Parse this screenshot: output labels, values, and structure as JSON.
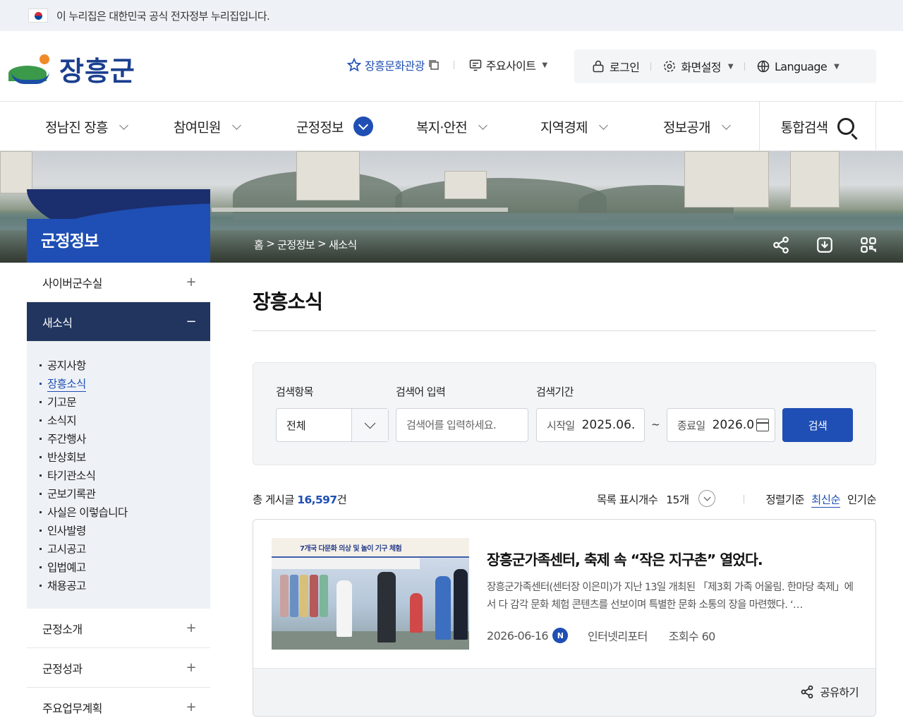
{
  "gov_banner": {
    "text": "이 누리집은 대한민국 공식 전자정부 누리집입니다."
  },
  "header": {
    "logo_text": "장흥군",
    "culture_tour": "장흥문화관광",
    "main_sites": "주요사이트",
    "login": "로그인",
    "screen_settings": "화면설정",
    "language": "Language"
  },
  "gnb": {
    "items": [
      {
        "label": "정남진 장흥"
      },
      {
        "label": "참여민원"
      },
      {
        "label": "군정정보"
      },
      {
        "label": "복지·안전"
      },
      {
        "label": "지역경제"
      },
      {
        "label": "정보공개"
      }
    ],
    "active_index": 2,
    "search_label": "통합검색"
  },
  "visual": {
    "section_title": "군정정보",
    "breadcrumb": [
      "홈",
      "군정정보",
      "새소식"
    ]
  },
  "lnb": {
    "items": [
      {
        "label": "사이버군수실",
        "toggle": "+"
      },
      {
        "label": "새소식",
        "toggle": "−"
      },
      {
        "label": "군정소개",
        "toggle": "+"
      },
      {
        "label": "군정성과",
        "toggle": "+"
      },
      {
        "label": "주요업무계획",
        "toggle": "+"
      }
    ],
    "sub_items": [
      "공지사항",
      "장흥소식",
      "기고문",
      "소식지",
      "주간행사",
      "반상회보",
      "타기관소식",
      "군보기록관",
      "사실은 이렇습니다",
      "인사발령",
      "고시공고",
      "입법예고",
      "채용공고"
    ],
    "sub_active_index": 1
  },
  "content": {
    "title": "장흥소식"
  },
  "search": {
    "label_category": "검색항목",
    "label_keyword": "검색어 입력",
    "label_period": "검색기간",
    "category_value": "전체",
    "keyword_placeholder": "검색어를 입력하세요.",
    "start_label": "시작일",
    "start_value": "2025.06.",
    "tilde": "~",
    "end_label": "종료일",
    "end_value": "2026.0",
    "button": "검색"
  },
  "list_bar": {
    "total_prefix": "총 게시글",
    "total_count": "16,597",
    "total_suffix": "건",
    "per_page_label": "목록 표시개수",
    "per_page_value": "15개",
    "sort_label": "정렬기준",
    "sort_latest": "최신순",
    "sort_popular": "인기순"
  },
  "post": {
    "thumb_banner": "7개국 다문화 의상 및 놀이 기구 체험",
    "title": "장흥군가족센터, 축제 속 “작은 지구촌” 열었다.",
    "desc": "장흥군가족센터(센터장 이은미)가 지난 13일 개최된 「제3회 가족 어울림. 한마당 축제」에서 다 감각 문화 체험 콘텐츠를 선보이며 특별한 문화 소통의 장을 마련했다. ‘…",
    "date": "2026-06-16",
    "new_badge": "N",
    "writer": "인터넷리포터",
    "views": "조회수 60",
    "share": "공유하기"
  },
  "colors": {
    "primary": "#1f4fb4",
    "lnb_active": "#21355f",
    "gov_bar": "#eef1f6"
  }
}
